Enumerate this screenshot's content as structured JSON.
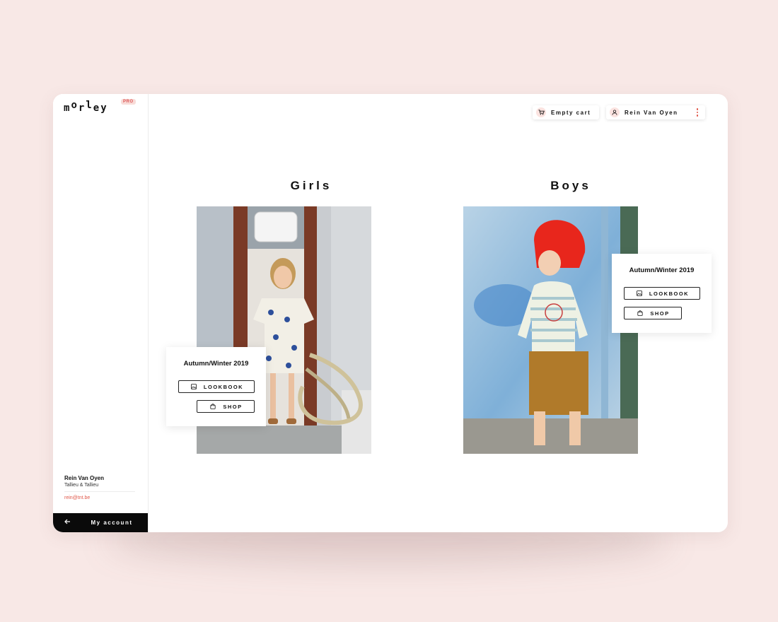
{
  "app": {
    "logo_letters": [
      "m",
      "o",
      "r",
      "l",
      "e",
      "y"
    ],
    "badge": "PRO"
  },
  "topbar": {
    "cart_label": "Empty cart",
    "user_label": "Rein Van Oyen"
  },
  "sidebar": {
    "user_name": "Rein Van Oyen",
    "company": "Tallieu & Tallieu",
    "email": "rein@tnt.be",
    "account_label": "My account",
    "back_icon": "arrow-left-icon"
  },
  "categories": [
    {
      "title": "Girls",
      "season": "Autumn/Winter 2019",
      "lookbook_label": "LOOKBOOK",
      "shop_label": "SHOP"
    },
    {
      "title": "Boys",
      "season": "Autumn/Winter 2019",
      "lookbook_label": "LOOKBOOK",
      "shop_label": "SHOP"
    }
  ],
  "colors": {
    "accent": "#e0584a",
    "accent_soft": "#fbe3e0",
    "background": "#f8e8e6",
    "dark": "#0a0a0a"
  },
  "icons": {
    "cart": "cart-icon",
    "user": "user-icon",
    "menu": "kebab-menu-icon",
    "lookbook": "image-icon",
    "shop": "shopping-bag-icon"
  }
}
